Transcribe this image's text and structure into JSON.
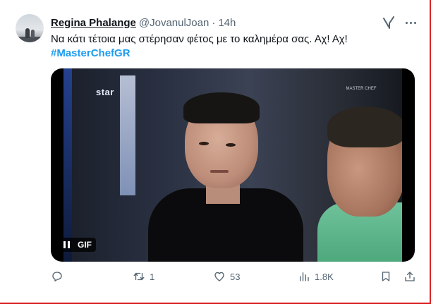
{
  "author": {
    "display_name": "Regina Phalange",
    "handle": "@JovanulJoan",
    "separator": "·",
    "time": "14h"
  },
  "tweet": {
    "text": "Να κάτι τέτοια μας στέρησαν φέτος με το καλημέρα σας. Αχ! Αχ!",
    "hashtag": "#MasterChefGR"
  },
  "media": {
    "type": "gif",
    "badge": "GIF",
    "overlay_logo": "star",
    "overlay_logo_right": "MASTER CHEF"
  },
  "actions": {
    "reply_count": "",
    "retweet_count": "1",
    "like_count": "53",
    "views_count": "1.8K"
  },
  "icons": {
    "grok": "grok-icon",
    "more": "more-icon",
    "reply": "reply-icon",
    "retweet": "retweet-icon",
    "like": "heart-icon",
    "views": "views-icon",
    "bookmark": "bookmark-icon",
    "share": "share-icon",
    "pause": "pause-icon"
  },
  "colors": {
    "accent": "#1d9bf0",
    "text": "#0f1419",
    "muted": "#536471",
    "border": "#d81b1b"
  }
}
